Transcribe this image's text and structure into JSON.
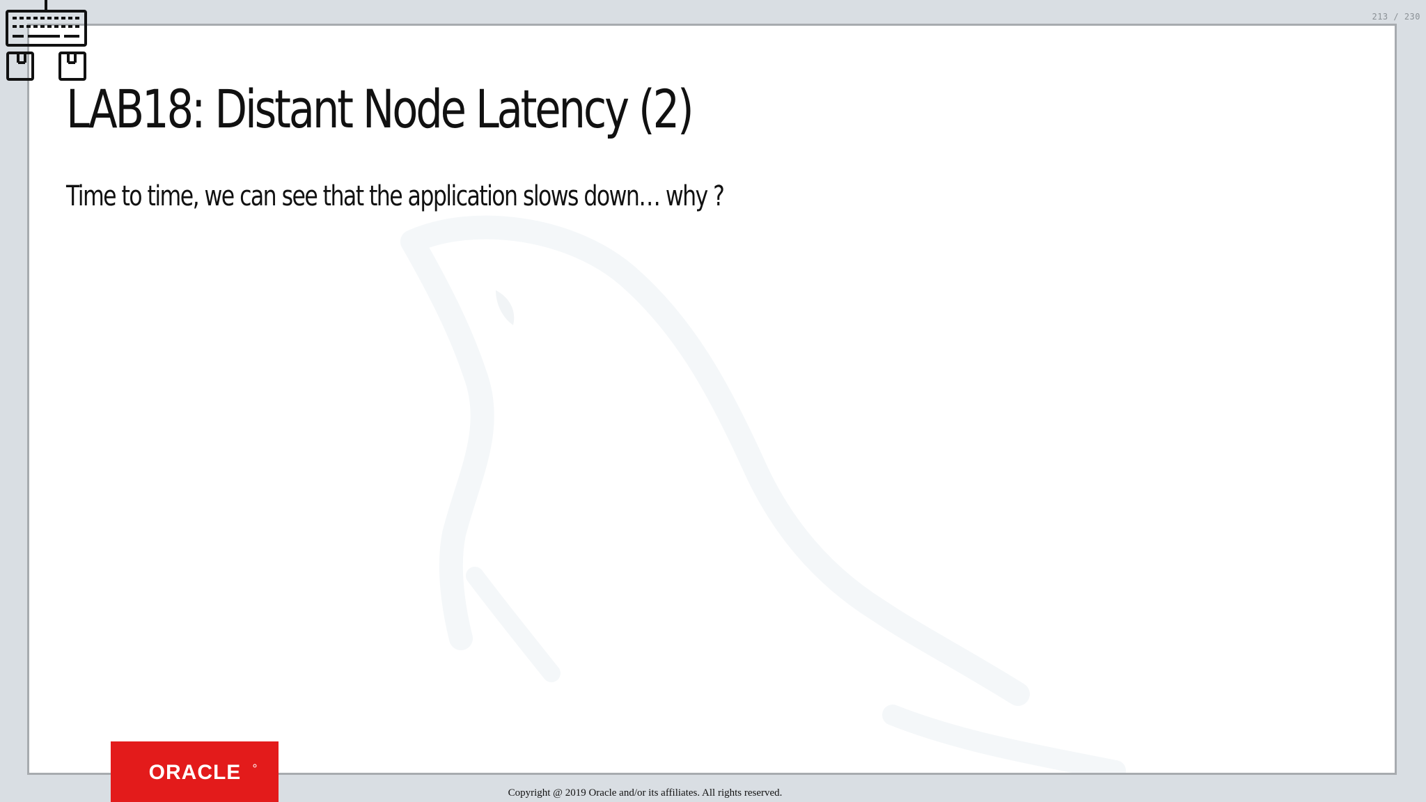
{
  "slide": {
    "counter": "213 / 230",
    "title": "LAB18: Distant Node Latency (2)",
    "body": "Time to time, we can see that the application slows down… why ?"
  },
  "footer": {
    "logo_text": "ORACLE",
    "copyright": "Copyright @ 2019 Oracle and/or its affiliates. All rights reserved."
  },
  "colors": {
    "background": "#d9dee3",
    "slide": "#ffffff",
    "slide_border": "#a7abaf",
    "text": "#111111",
    "oracle_red": "#e31b1b"
  },
  "icons": {
    "overlay": "keyboard-mouse-icon",
    "watermark": "mysql-dolphin-watermark"
  }
}
